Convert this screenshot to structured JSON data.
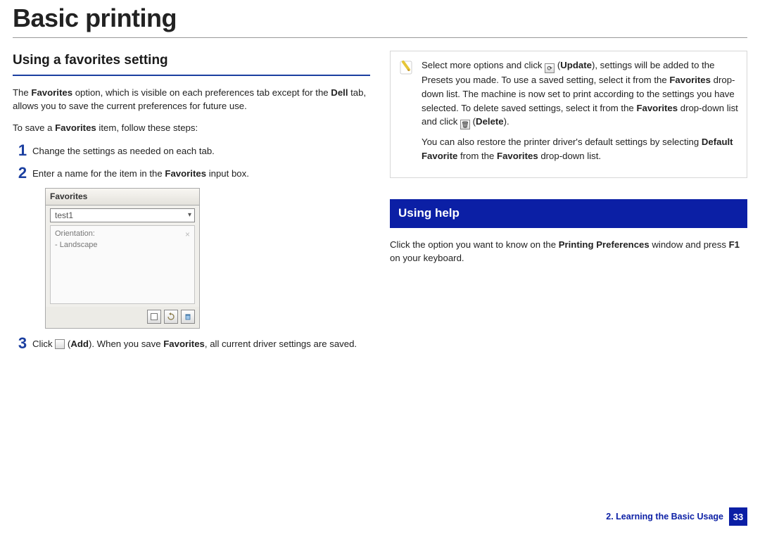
{
  "page": {
    "title": "Basic printing"
  },
  "left": {
    "heading": "Using a favorites setting",
    "p1_a": "The ",
    "p1_b": "Favorites",
    "p1_c": " option, which is visible on each preferences tab except for the ",
    "p1_d": "Dell",
    "p1_e": " tab, allows you to save the current preferences for future use.",
    "p2_a": "To save a ",
    "p2_b": "Favorites",
    "p2_c": " item, follow these steps:",
    "step1": {
      "num": "1",
      "text": "Change the settings as needed on each tab."
    },
    "step2": {
      "num": "2",
      "a": "Enter a name for the item in the ",
      "b": "Favorites",
      "c": " input box."
    },
    "favbox": {
      "header": "Favorites",
      "selected": "test1",
      "detail1": "Orientation:",
      "detail2": "- Landscape"
    },
    "step3": {
      "num": "3",
      "a": "Click ",
      "b": " (",
      "c": "Add",
      "d": "). When you save ",
      "e": "Favorites",
      "f": ", all current driver settings are saved."
    }
  },
  "right": {
    "tip": {
      "p1_a": "Select more options and click ",
      "p1_b": " (",
      "p1_c": "Update",
      "p1_d": "), settings will be added to the Presets you made. To use a saved setting, select it from the ",
      "p1_e": "Favorites",
      "p1_f": " drop-down list. The machine is now set to print according to the settings you have selected. To delete saved settings, select it from the ",
      "p1_g": "Favorites",
      "p1_h": " drop-down list and click ",
      "p1_i": "  (",
      "p1_j": "Delete",
      "p1_k": ").",
      "p2_a": "You can also restore the printer driver's default settings by selecting ",
      "p2_b": "Default Favorite",
      "p2_c": " from the ",
      "p2_d": "Favorites",
      "p2_e": " drop-down list."
    },
    "help": {
      "heading": "Using help",
      "p_a": "Click the option you want to know on the ",
      "p_b": "Printing Preferences",
      "p_c": " window and press ",
      "p_d": "F1",
      "p_e": " on your keyboard."
    }
  },
  "footer": {
    "chapter": "2. Learning the Basic Usage",
    "page": "33"
  }
}
